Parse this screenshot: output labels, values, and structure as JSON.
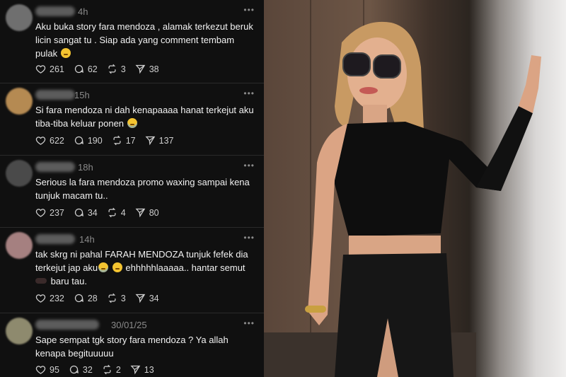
{
  "feed": {
    "posts": [
      {
        "time": "4h",
        "text": "Aku buka story fara mendoza , alamak terkezut beruk licin sangat tu . Siap ada yang comment tembam pulak",
        "emojis": [
          "laughing-face"
        ],
        "likes": "261",
        "replies": "62",
        "reposts": "3",
        "shares": "38",
        "avatar_color": "#6f6f6f"
      },
      {
        "time": "15h",
        "text": "Si fara mendoza ni dah kenapaaaa hanat terkejut aku tiba-tiba keluar ponen",
        "emojis": [
          "crying-laughing-face"
        ],
        "likes": "622",
        "replies": "190",
        "reposts": "17",
        "shares": "137",
        "avatar_color": "#b58a52"
      },
      {
        "time": "18h",
        "text": "Serious la fara mendoza promo waxing sampai kena tunjuk macam tu..",
        "emojis": [],
        "likes": "237",
        "replies": "34",
        "reposts": "4",
        "shares": "80",
        "avatar_color": "#4a4a4a"
      },
      {
        "time": "14h",
        "text_line1": "tak skrg ni pahal FARAH MENDOZA tunjuk fefek dia",
        "text_line2a": "terkejut jap aku",
        "text_line2b": " ehhhhhlaaaaa.. hantar semut",
        "text_line3": "baru tau.",
        "emojis": [
          "crying-face",
          "weary-face",
          "ant"
        ],
        "likes": "232",
        "replies": "28",
        "reposts": "3",
        "shares": "34",
        "avatar_color": "#a58080"
      },
      {
        "time": "30/01/25",
        "text": "Sape sempat tgk story fara mendoza ? Ya allah kenapa begituuuuu",
        "emojis": [],
        "likes": "95",
        "replies": "32",
        "reposts": "2",
        "shares": "13",
        "avatar_color": "#8e8a6e"
      }
    ],
    "more_glyph": "•••"
  },
  "icons": {
    "like": "heart-icon",
    "reply": "speech-bubble-icon",
    "repost": "repost-icon",
    "share": "paper-plane-icon"
  },
  "photo": {
    "description_icon": "person-photo",
    "outfit_color": "#0e0e0e"
  }
}
